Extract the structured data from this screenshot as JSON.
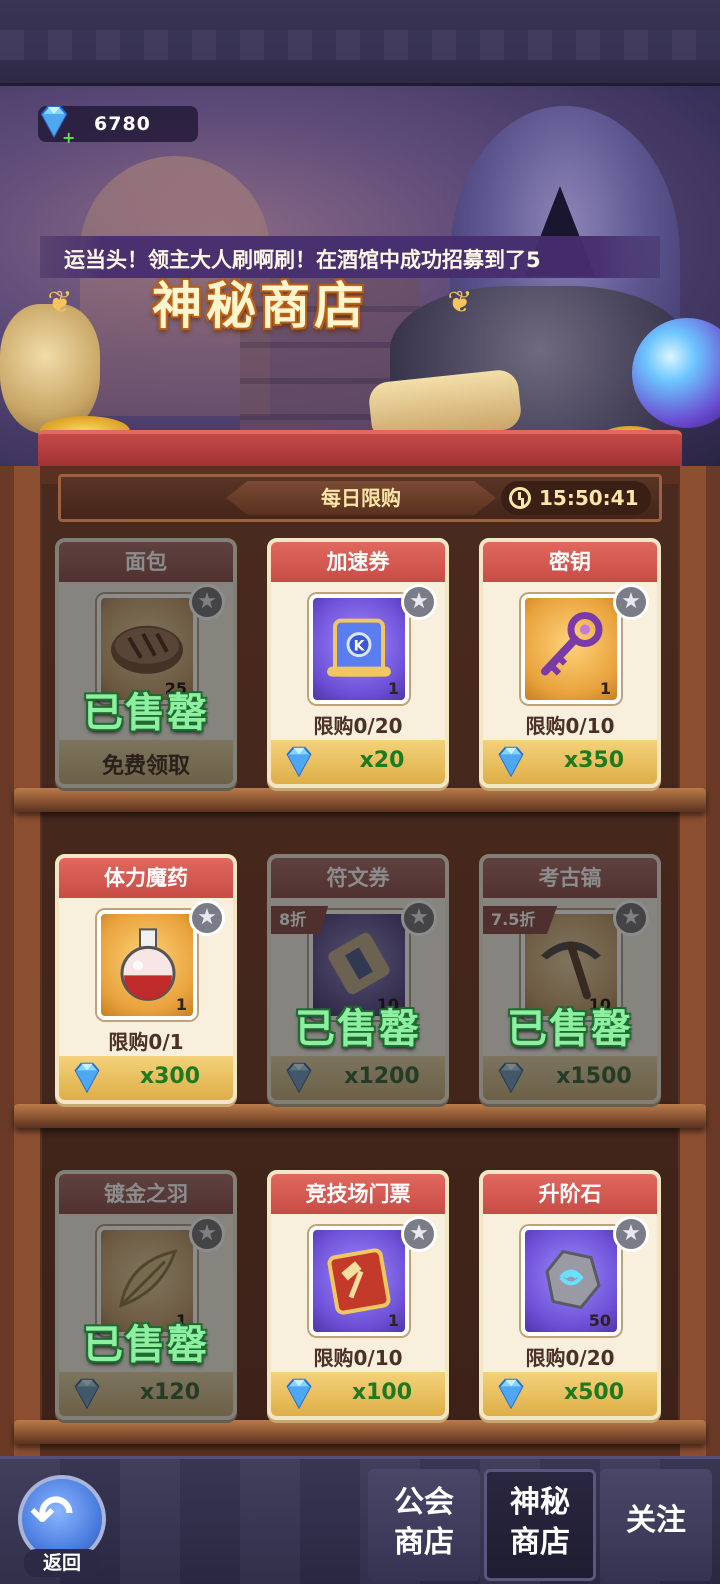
{
  "header": {
    "gem_count": "6780",
    "ticker_text": "运当头！领主大人刷啊刷！在酒馆中成功招募到了5",
    "shop_title": "神秘商店"
  },
  "daily": {
    "label": "每日限购",
    "timer": "15:50:41"
  },
  "items": [
    {
      "name": "面包",
      "qty": "25",
      "limit": "",
      "price": "免费领取",
      "sold": true,
      "sold_label": "已售罄"
    },
    {
      "name": "加速券",
      "qty": "1",
      "limit": "限购0/20",
      "price": "x20",
      "sold": false
    },
    {
      "name": "密钥",
      "qty": "1",
      "limit": "限购0/10",
      "price": "x350",
      "sold": false
    },
    {
      "name": "体力魔药",
      "qty": "1",
      "limit": "限购0/1",
      "price": "x300",
      "sold": false
    },
    {
      "name": "符文券",
      "qty": "10",
      "discount": "8折",
      "price": "x1200",
      "sold": true,
      "sold_label": "已售罄"
    },
    {
      "name": "考古镐",
      "qty": "10",
      "discount": "7.5折",
      "price": "x1500",
      "sold": true,
      "sold_label": "已售罄"
    },
    {
      "name": "镀金之羽",
      "qty": "1",
      "price": "x120",
      "sold": true,
      "sold_label": "已售罄"
    },
    {
      "name": "竞技场门票",
      "qty": "1",
      "limit": "限购0/10",
      "price": "x100",
      "sold": false
    },
    {
      "name": "升阶石",
      "qty": "50",
      "limit": "限购0/20",
      "price": "x500",
      "sold": false
    }
  ],
  "nav": {
    "back_label": "返回",
    "guild_shop": [
      "公会",
      "商店"
    ],
    "mystery_shop": [
      "神秘",
      "商店"
    ],
    "follow": "关注"
  },
  "colors": {
    "card_title": "#d85a52",
    "price_text": "#1e7a20",
    "sold_text": "#8cf0a0",
    "price_bar": "#e8bb58"
  }
}
